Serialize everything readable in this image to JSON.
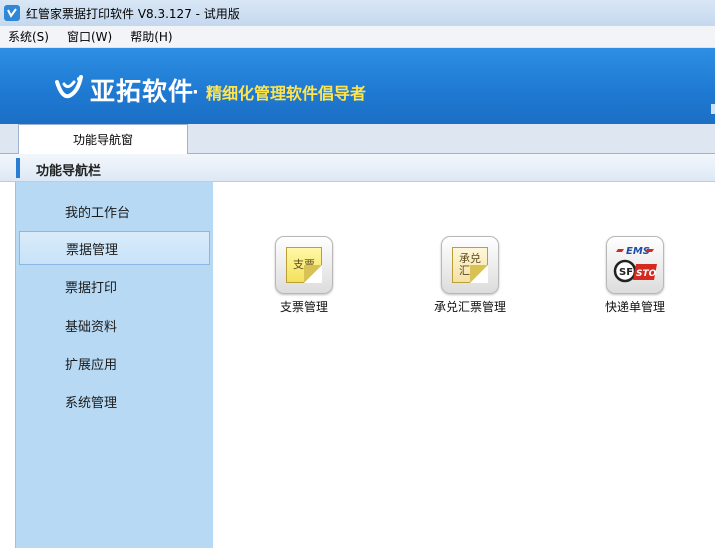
{
  "window": {
    "title": "红管家票据打印软件 V8.3.127 - 试用版"
  },
  "menu": [
    {
      "label": "系统(S)"
    },
    {
      "label": "窗口(W)"
    },
    {
      "label": "帮助(H)"
    }
  ],
  "banner": {
    "brand": "亚拓软件",
    "dot": "·",
    "slogan": "精细化管理软件倡导者"
  },
  "tabs": [
    {
      "label": "功能导航窗"
    }
  ],
  "nav": {
    "header": "功能导航栏",
    "items": [
      {
        "label": "我的工作台",
        "active": false
      },
      {
        "label": "票据管理",
        "active": true
      },
      {
        "label": "票据打印",
        "active": false
      },
      {
        "label": "基础资料",
        "active": false
      },
      {
        "label": "扩展应用",
        "active": false
      },
      {
        "label": "系统管理",
        "active": false
      }
    ]
  },
  "tiles": [
    {
      "label": "支票管理",
      "icon": "cheque-icon",
      "icon_text": "支票"
    },
    {
      "label": "承兑汇票管理",
      "icon": "acceptance-bill-icon",
      "icon_text": "承兑汇票"
    },
    {
      "label": "快递单管理",
      "icon": "express-waybill-icon",
      "icon_text": "EMS SF STO"
    }
  ],
  "colors": {
    "banner_blue": "#1f7ad3",
    "slogan_yellow": "#ffe44d",
    "sidebar_blue": "#b7d9f4",
    "ems_blue": "#1b4fa6",
    "sto_red": "#d42a1f"
  }
}
